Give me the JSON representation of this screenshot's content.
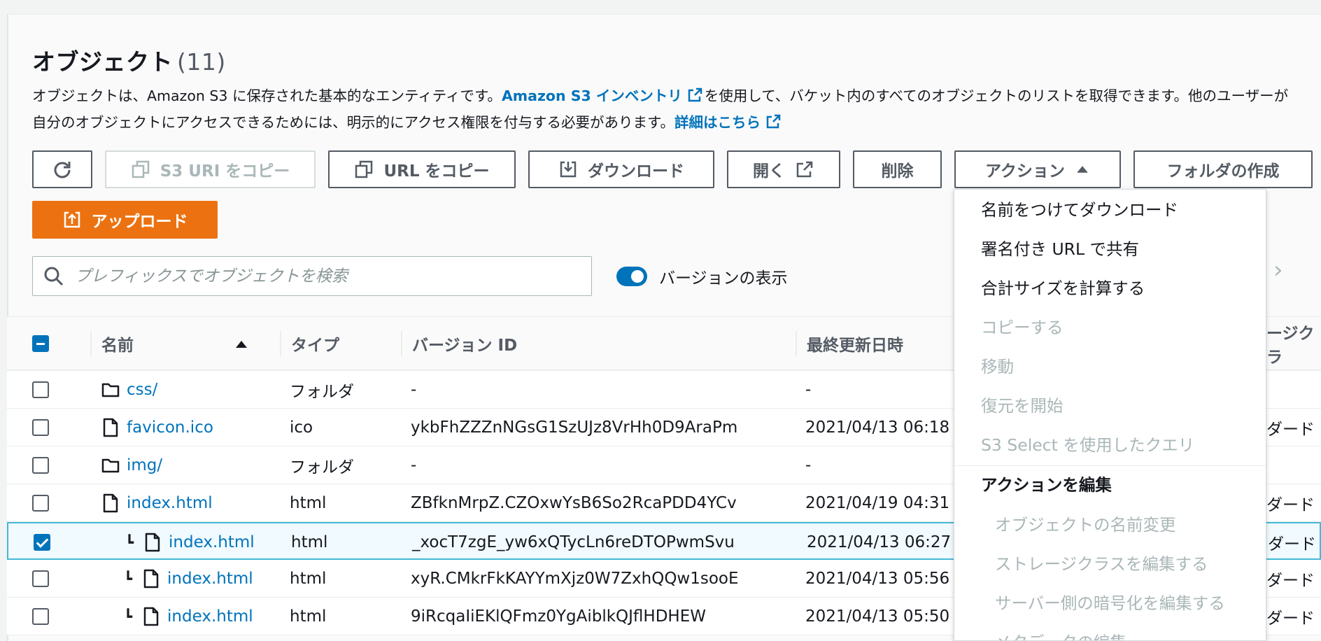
{
  "header": {
    "title": "オブジェクト",
    "count": "(11)"
  },
  "description": {
    "line1_a": "オブジェクトは、Amazon S3 に保存された基本的なエンティティです。",
    "inventory_link": "Amazon S3 インベントリ",
    "line1_b": "を使用して、バケット内のすべてのオブジェクトのリストを取得できます。他のユーザーが",
    "line2_a": "自分のオブジェクトにアクセスできるためには、明示的にアクセス権限を付与する必要があります。",
    "details_link": "詳細はこちら"
  },
  "toolbar": {
    "copy_s3_uri": "S3 URI をコピー",
    "copy_url": "URL をコピー",
    "download": "ダウンロード",
    "open": "開く",
    "delete": "削除",
    "actions": "アクション",
    "create_folder": "フォルダの作成",
    "upload": "アップロード"
  },
  "search": {
    "placeholder": "プレフィックスでオブジェクトを検索"
  },
  "versions_toggle": {
    "label": "バージョンの表示",
    "on": true
  },
  "table": {
    "columns": {
      "name": "名前",
      "type": "タイプ",
      "version_id": "バージョン ID",
      "last_modified": "最終更新日時",
      "storage_class": "ージクラ"
    },
    "rows": [
      {
        "name": "css/",
        "kind": "folder",
        "type": "フォルダ",
        "version": "-",
        "modified": "-",
        "storage": "",
        "child": false,
        "checked": false
      },
      {
        "name": "favicon.ico",
        "kind": "file",
        "type": "ico",
        "version": "ykbFhZZZnNGsG1SzUJz8VrHh0D9AraPm",
        "modified": "2021/04/13 06:18",
        "storage": "ダード",
        "child": false,
        "checked": false
      },
      {
        "name": "img/",
        "kind": "folder",
        "type": "フォルダ",
        "version": "-",
        "modified": "-",
        "storage": "",
        "child": false,
        "checked": false
      },
      {
        "name": "index.html",
        "kind": "file",
        "type": "html",
        "version": "ZBfknMrpZ.CZOxwYsB6So2RcaPDD4YCv",
        "modified": "2021/04/19 04:31",
        "storage": "ダード",
        "child": false,
        "checked": false
      },
      {
        "name": "index.html",
        "kind": "file",
        "type": "html",
        "version": "_xocT7zgE_yw6xQTycLn6reDTOPwmSvu",
        "modified": "2021/04/13 06:27",
        "storage": "ダード",
        "child": true,
        "checked": true
      },
      {
        "name": "index.html",
        "kind": "file",
        "type": "html",
        "version": "xyR.CMkrFkKAYYmXjz0W7ZxhQQw1sooE",
        "modified": "2021/04/13 05:56",
        "storage": "ダード",
        "child": true,
        "checked": false
      },
      {
        "name": "index.html",
        "kind": "file",
        "type": "html",
        "version": "9iRcqaIiEKlQFmz0YgAiblkQJflHDHEW",
        "modified": "2021/04/13 05:50",
        "storage": "ダード",
        "child": true,
        "checked": false
      }
    ]
  },
  "actions_menu": {
    "items": [
      {
        "label": "名前をつけてダウンロード",
        "enabled": true
      },
      {
        "label": "署名付き URL で共有",
        "enabled": true
      },
      {
        "label": "合計サイズを計算する",
        "enabled": true
      },
      {
        "label": "コピーする",
        "enabled": false
      },
      {
        "label": "移動",
        "enabled": false
      },
      {
        "label": "復元を開始",
        "enabled": false
      },
      {
        "label": "S3 Select を使用したクエリ",
        "enabled": false
      }
    ],
    "edit_header": "アクションを編集",
    "edit_items": [
      {
        "label": "オブジェクトの名前変更",
        "enabled": false
      },
      {
        "label": "ストレージクラスを編集する",
        "enabled": false
      },
      {
        "label": "サーバー側の暗号化を編集する",
        "enabled": false
      },
      {
        "label": "メタデータの編集",
        "enabled": false
      }
    ]
  },
  "colors": {
    "accent": "#0073bb",
    "upload": "#ec7211",
    "selected_border": "#44b9d6"
  }
}
